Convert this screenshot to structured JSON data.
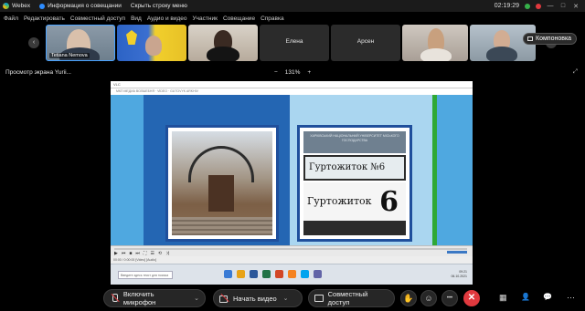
{
  "titlebar": {
    "app_name": "Webex",
    "meeting_info": "Информация о совещании",
    "hide_menu": "Скрыть строку меню",
    "time": "02:19:29",
    "minimize": "—",
    "maximize": "□",
    "close": "✕"
  },
  "menu": {
    "items": [
      "Файл",
      "Редактировать",
      "Совместный доступ",
      "Вид",
      "Аудио и видео",
      "Участник",
      "Совещание",
      "Справка"
    ]
  },
  "participants": {
    "prev_arrow": "‹",
    "next_arrow": "›",
    "tiles": [
      {
        "name": "Tetiana Nemova"
      },
      {
        "name": ""
      },
      {
        "name": ""
      },
      {
        "name": "Елена"
      },
      {
        "name": "Арсен"
      },
      {
        "name": ""
      },
      {
        "name": ""
      }
    ],
    "layout_label": "Компоновка"
  },
  "share": {
    "label": "Просмотр экрана Yurii...",
    "zoom_minus": "−",
    "zoom_value": "131%",
    "zoom_plus": "+",
    "expand": "⤢"
  },
  "shared_screen": {
    "window_title": "VLC",
    "subtitle": "МКП МЕДИА ВОЛШЕБНЯ · VIDEO · GUTOVYK ARKHIV",
    "sign_header": "ХАРКІВСЬКИЙ НАЦІОНАЛЬНИЙ УНІВЕРСИТЕТ МІСЬКОГО ГОСПОДАРСТВА",
    "sign_band": "Гуртожиток №6",
    "sign_word": "Гуртожиток",
    "sign_number": "6",
    "status": "00:00 / 0:00:00  [Video] [Audio]",
    "taskbar_search": "Введите здесь текст для поиска",
    "taskbar_clock": "09:21",
    "taskbar_date": "06.10.2021",
    "player_controls": [
      "▶",
      "⏮",
      "■",
      "⏭",
      "⛶",
      "☰",
      "⟲",
      "⤨"
    ]
  },
  "controls": {
    "mic_label": "Включить микрофон",
    "video_label": "Начать видео",
    "share_label": "Совместный доступ",
    "caret": "⌄",
    "hand_icon": "✋",
    "reactions_icon": "☺",
    "more_icon": "•••",
    "end_icon": "✕",
    "apps_icon": "▦",
    "participants_icon": "👤",
    "chat_icon": "💬",
    "more_right_icon": "⋯"
  },
  "colors": {
    "end_call": "#e0393e",
    "accent": "#2d8cff",
    "slide_blue": "#4fa8e0"
  }
}
